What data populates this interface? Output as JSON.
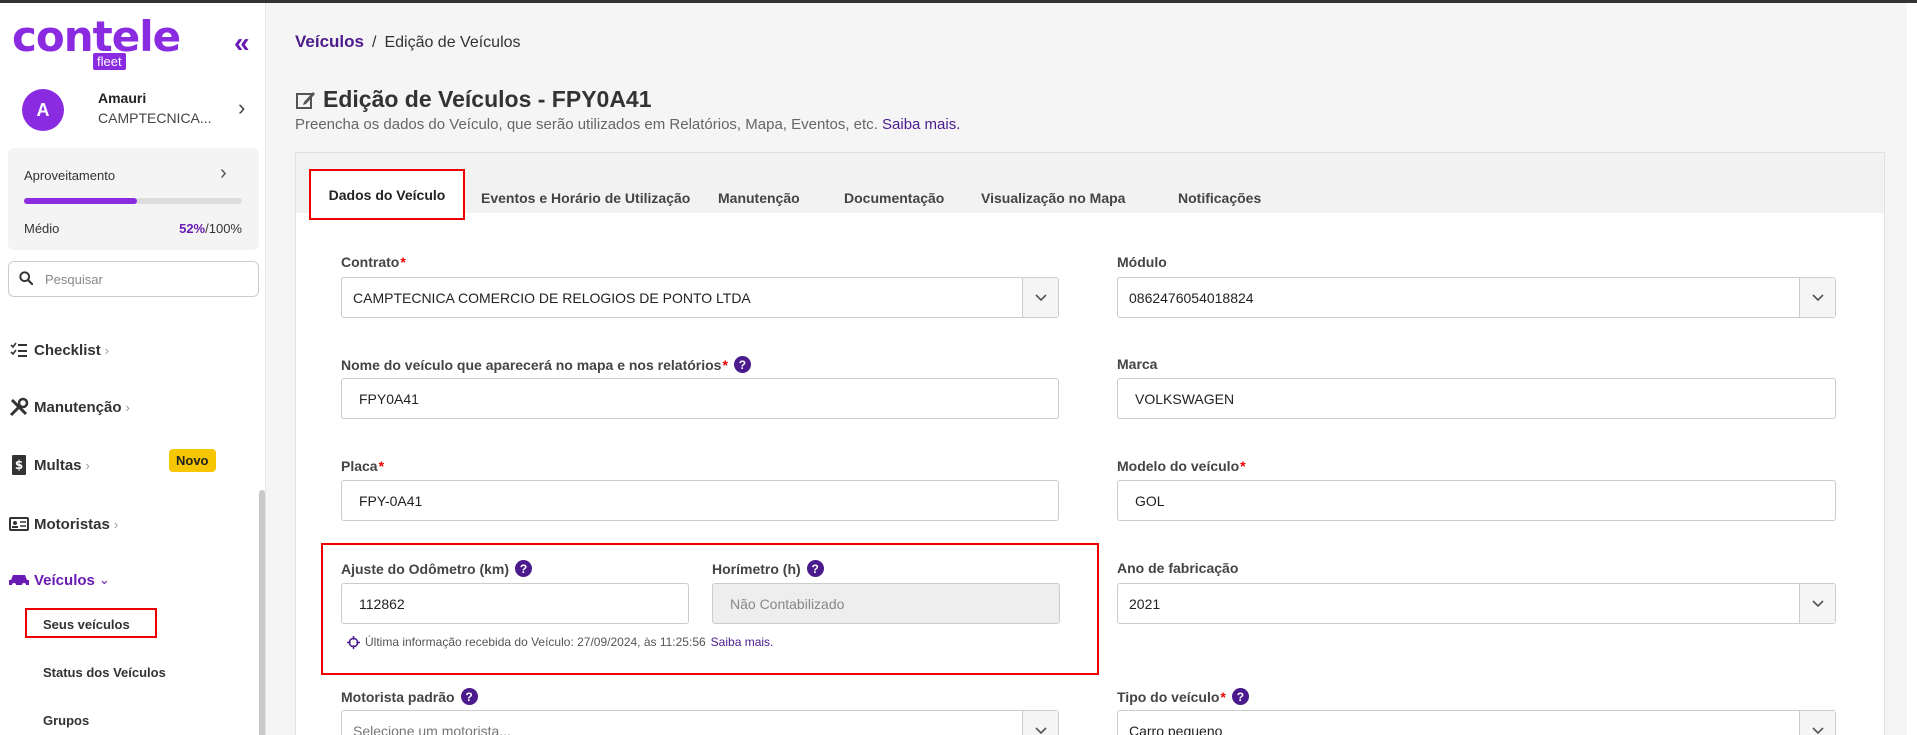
{
  "app": {
    "logo_word": "contele",
    "logo_badge": "fleet"
  },
  "user": {
    "initial": "A",
    "name": "Amauri",
    "company": "CAMPTECNICA..."
  },
  "usage": {
    "label": "Aproveitamento",
    "level": "Médio",
    "percent": "52%",
    "total": "/100%",
    "fill_percent": 52
  },
  "search": {
    "placeholder": "Pesquisar"
  },
  "sidebar": {
    "items": [
      {
        "label": "Checklist",
        "icon": "checklist-icon"
      },
      {
        "label": "Manutenção",
        "icon": "tools-icon"
      },
      {
        "label": "Multas",
        "icon": "fine-icon",
        "badge": "Novo"
      },
      {
        "label": "Motoristas",
        "icon": "id-card-icon"
      },
      {
        "label": "Veículos",
        "icon": "car-icon",
        "active": true
      }
    ],
    "sub_items": [
      "Seus veículos",
      "Status dos Veículos",
      "Grupos"
    ]
  },
  "breadcrumb": {
    "parent": "Veículos",
    "separator": "/",
    "current": "Edição de Veículos"
  },
  "page": {
    "title": "Edição de Veículos - FPY0A41",
    "subtitle": "Preencha os dados do Veículo, que serão utilizados em Relatórios, Mapa, Eventos, etc.",
    "subtitle_link": "Saiba mais."
  },
  "tabs": [
    "Dados do Veículo",
    "Eventos e Horário de Utilização",
    "Manutenção",
    "Documentação",
    "Visualização no Mapa",
    "Notificações"
  ],
  "form": {
    "contrato": {
      "label": "Contrato",
      "required": "*",
      "value": "CAMPTECNICA COMERCIO DE RELOGIOS DE PONTO LTDA"
    },
    "modulo": {
      "label": "Módulo",
      "value": "0862476054018824"
    },
    "nome": {
      "label": "Nome do veículo que aparecerá no mapa e nos relatórios",
      "required": "*",
      "value": "FPY0A41"
    },
    "marca": {
      "label": "Marca",
      "value": "VOLKSWAGEN"
    },
    "placa": {
      "label": "Placa",
      "required": "*",
      "value": "FPY-0A41"
    },
    "modelo": {
      "label": "Modelo do veículo",
      "required": "*",
      "value": "GOL"
    },
    "odometro": {
      "label": "Ajuste do Odômetro (km)",
      "value": "112862"
    },
    "horimetro": {
      "label": "Horímetro (h)",
      "value": "Não Contabilizado"
    },
    "ano": {
      "label": "Ano de fabricação",
      "value": "2021"
    },
    "last_info": "Última informação recebida do Veículo: 27/09/2024, às 11:25:56",
    "last_info_link": "Saiba mais.",
    "motorista": {
      "label": "Motorista padrão",
      "placeholder": "Selecione um motorista..."
    },
    "tipo": {
      "label": "Tipo do veículo",
      "required": "*",
      "value": "Carro pequeno"
    },
    "help_glyph": "?"
  },
  "colors": {
    "brand": "#8a2be2",
    "brand_dark": "#4b1a8c",
    "highlight": "#ee0000",
    "badge": "#f6c600"
  }
}
